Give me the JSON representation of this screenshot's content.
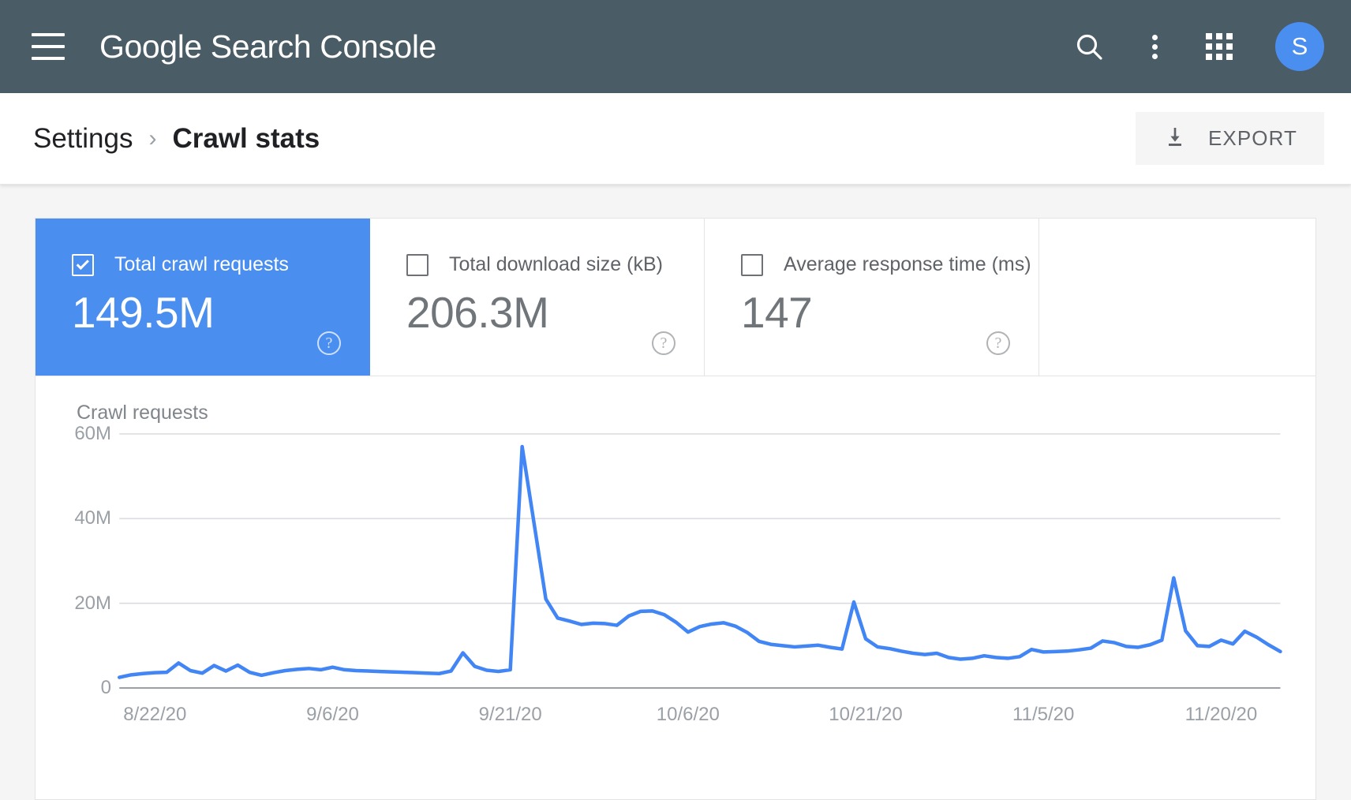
{
  "appbar": {
    "brand_google": "Google",
    "brand_rest": " Search Console",
    "menu_icon": "hamburger-menu-icon",
    "search_icon": "search-icon",
    "more_icon": "more-vert-icon",
    "apps_icon": "apps-grid-icon",
    "avatar_initial": "S",
    "bg_color": "#4a5c66",
    "avatar_color": "#4a8ef0"
  },
  "breadcrumb": {
    "parent": "Settings",
    "separator": "›",
    "current": "Crawl stats"
  },
  "export": {
    "label": "EXPORT",
    "icon": "download-icon"
  },
  "metrics": [
    {
      "label": "Total crawl requests",
      "value": "149.5M",
      "checked": true,
      "selected": true,
      "help": "?"
    },
    {
      "label": "Total download size (kB)",
      "value": "206.3M",
      "checked": false,
      "selected": false,
      "help": "?"
    },
    {
      "label": "Average response time (ms)",
      "value": "147",
      "checked": false,
      "selected": false,
      "help": "?"
    }
  ],
  "chart_data": {
    "type": "line",
    "title": "Crawl requests",
    "xlabel": "",
    "ylabel": "Crawl requests",
    "ylim": [
      0,
      60000000
    ],
    "yticks": [
      0,
      20000000,
      40000000,
      60000000
    ],
    "ytick_labels": [
      "0",
      "20M",
      "40M",
      "60M"
    ],
    "grid": true,
    "legend": false,
    "line_color": "#4285f4",
    "x_tick_labels": [
      "8/22/20",
      "9/6/20",
      "9/21/20",
      "10/6/20",
      "10/21/20",
      "11/5/20",
      "11/20/20"
    ],
    "x_tick_indices": [
      3,
      18,
      33,
      48,
      63,
      78,
      93
    ],
    "x": [
      "8/19/20",
      "8/20/20",
      "8/21/20",
      "8/22/20",
      "8/23/20",
      "8/24/20",
      "8/25/20",
      "8/26/20",
      "8/27/20",
      "8/28/20",
      "8/29/20",
      "8/30/20",
      "8/31/20",
      "9/1/20",
      "9/2/20",
      "9/3/20",
      "9/4/20",
      "9/5/20",
      "9/6/20",
      "9/7/20",
      "9/8/20",
      "9/9/20",
      "9/10/20",
      "9/11/20",
      "9/12/20",
      "9/13/20",
      "9/14/20",
      "9/15/20",
      "9/16/20",
      "9/17/20",
      "9/18/20",
      "9/19/20",
      "9/20/20",
      "9/21/20",
      "9/22/20",
      "9/23/20",
      "9/24/20",
      "9/25/20",
      "9/26/20",
      "9/27/20",
      "9/28/20",
      "9/29/20",
      "9/30/20",
      "10/1/20",
      "10/2/20",
      "10/3/20",
      "10/4/20",
      "10/5/20",
      "10/6/20",
      "10/7/20",
      "10/8/20",
      "10/9/20",
      "10/10/20",
      "10/11/20",
      "10/12/20",
      "10/13/20",
      "10/14/20",
      "10/15/20",
      "10/16/20",
      "10/17/20",
      "10/18/20",
      "10/19/20",
      "10/20/20",
      "10/21/20",
      "10/22/20",
      "10/23/20",
      "10/24/20",
      "10/25/20",
      "10/26/20",
      "10/27/20",
      "10/28/20",
      "10/29/20",
      "10/30/20",
      "10/31/20",
      "11/1/20",
      "11/2/20",
      "11/3/20",
      "11/4/20",
      "11/5/20",
      "11/6/20",
      "11/7/20",
      "11/8/20",
      "11/9/20",
      "11/10/20",
      "11/11/20",
      "11/12/20",
      "11/13/20",
      "11/14/20",
      "11/15/20",
      "11/16/20",
      "11/17/20",
      "11/18/20",
      "11/19/20",
      "11/20/20",
      "11/21/20",
      "11/22/20"
    ],
    "values": [
      2500000,
      3100000,
      3400000,
      3600000,
      3700000,
      5900000,
      4100000,
      3500000,
      5300000,
      4000000,
      5400000,
      3700000,
      3000000,
      3600000,
      4100000,
      4400000,
      4600000,
      4300000,
      4900000,
      4300000,
      4100000,
      4000000,
      3900000,
      3800000,
      3700000,
      3600000,
      3500000,
      3400000,
      4000000,
      8300000,
      5100000,
      4200000,
      3900000,
      4300000,
      57000000,
      39000000,
      21000000,
      16500000,
      15800000,
      15000000,
      15300000,
      15200000,
      14800000,
      17000000,
      18100000,
      18200000,
      17300000,
      15500000,
      13200000,
      14500000,
      15100000,
      15400000,
      14600000,
      13100000,
      11000000,
      10300000,
      10000000,
      9700000,
      9900000,
      10100000,
      9600000,
      9200000,
      20300000,
      11600000,
      9700000,
      9300000,
      8700000,
      8200000,
      7900000,
      8200000,
      7200000,
      6800000,
      7000000,
      7600000,
      7200000,
      7000000,
      7400000,
      9100000,
      8500000,
      8600000,
      8700000,
      9000000,
      9400000,
      11100000,
      10700000,
      9800000,
      9600000,
      10200000,
      11300000,
      26000000,
      13500000,
      10000000,
      9800000,
      11300000,
      10400000,
      13400000,
      12000000,
      10200000,
      8600000
    ]
  }
}
